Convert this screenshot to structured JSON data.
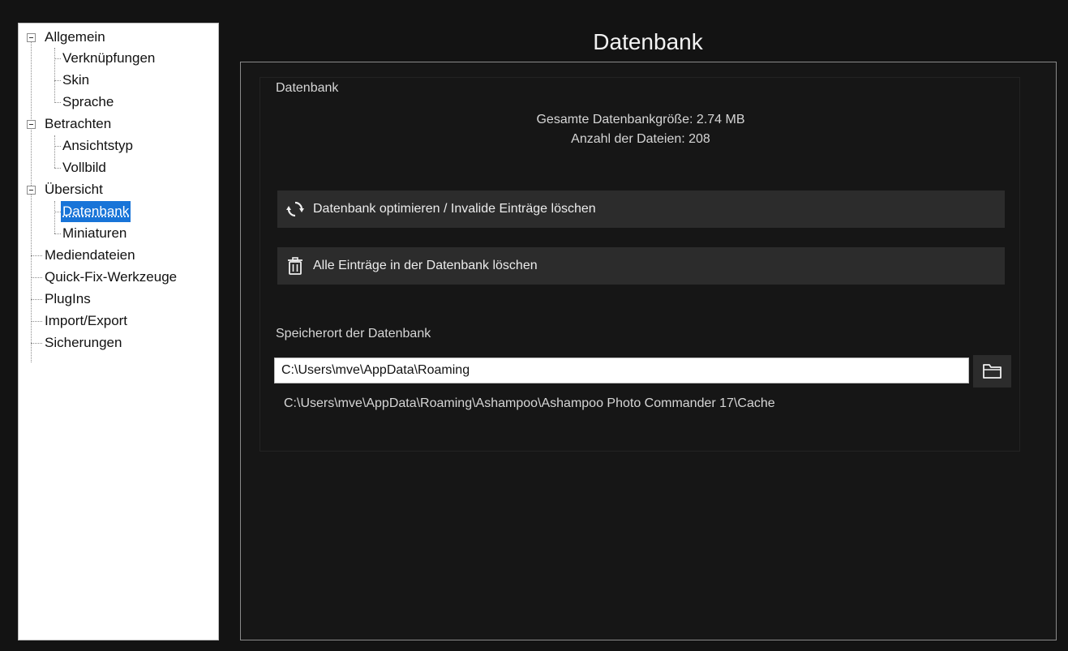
{
  "sidebar": {
    "groups": [
      {
        "label": "Allgemein",
        "children": [
          "Verknüpfungen",
          "Skin",
          "Sprache"
        ]
      },
      {
        "label": "Betrachten",
        "children": [
          "Ansichtstyp",
          "Vollbild"
        ]
      },
      {
        "label": "Übersicht",
        "children": [
          "Datenbank",
          "Miniaturen"
        ]
      }
    ],
    "items": [
      "Mediendateien",
      "Quick-Fix-Werkzeuge",
      "PlugIns",
      "Import/Export",
      "Sicherungen"
    ],
    "selected": "Datenbank"
  },
  "main": {
    "title": "Datenbank",
    "group_title": "Datenbank",
    "total_size": "Gesamte Datenbankgröße: 2.74 MB",
    "file_count": "Anzahl der Dateien: 208",
    "optimize_button": "Datenbank optimieren / Invalide Einträge löschen",
    "delete_all_button": "Alle Einträge in der Datenbank löschen",
    "location_label": "Speicherort der Datenbank",
    "location_value": "C:\\Users\\mve\\AppData\\Roaming",
    "full_path": "C:\\Users\\mve\\AppData\\Roaming\\Ashampoo\\Ashampoo Photo Commander 17\\Cache"
  },
  "icons": {
    "optimize": "refresh-icon",
    "delete": "trash-icon",
    "browse": "folder-icon"
  },
  "colors": {
    "background": "#131313",
    "button": "#2c2c2c",
    "selection": "#1874d8",
    "text": "#d6d6d6"
  }
}
